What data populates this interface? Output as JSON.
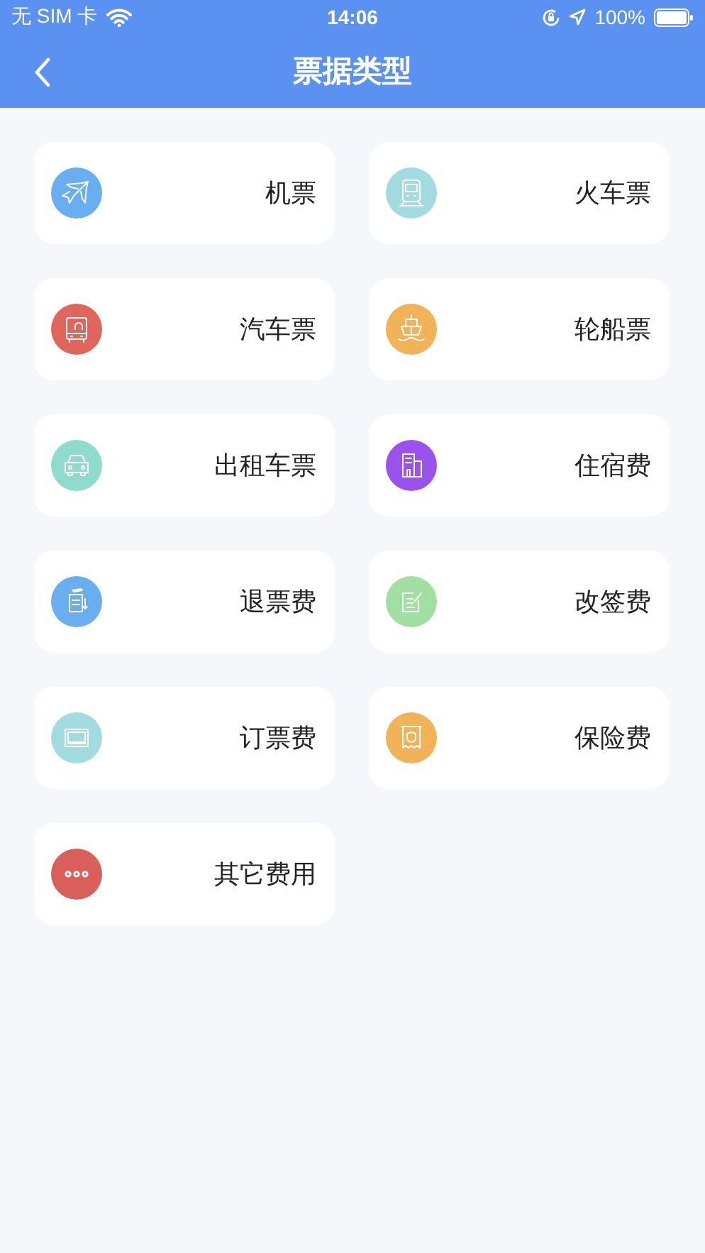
{
  "status_bar": {
    "carrier": "无 SIM 卡",
    "time": "14:06",
    "battery": "100%"
  },
  "nav": {
    "title": "票据类型"
  },
  "items": [
    {
      "label": "机票",
      "kind": "plane",
      "color": "#6aaef2"
    },
    {
      "label": "火车票",
      "kind": "train",
      "color": "#a2dbe0"
    },
    {
      "label": "汽车票",
      "kind": "bus",
      "color": "#e0655c"
    },
    {
      "label": "轮船票",
      "kind": "ship",
      "color": "#f2b257"
    },
    {
      "label": "出租车票",
      "kind": "car",
      "color": "#8fdbcd"
    },
    {
      "label": "住宿费",
      "kind": "building",
      "color": "#9b51ee"
    },
    {
      "label": "退票费",
      "kind": "refund",
      "color": "#6aaef2"
    },
    {
      "label": "改签费",
      "kind": "edit",
      "color": "#a2dfa2"
    },
    {
      "label": "订票费",
      "kind": "ticket",
      "color": "#a2dbe0"
    },
    {
      "label": "保险费",
      "kind": "insurance",
      "color": "#f2b257"
    },
    {
      "label": "其它费用",
      "kind": "more",
      "color": "#d9605a"
    }
  ]
}
